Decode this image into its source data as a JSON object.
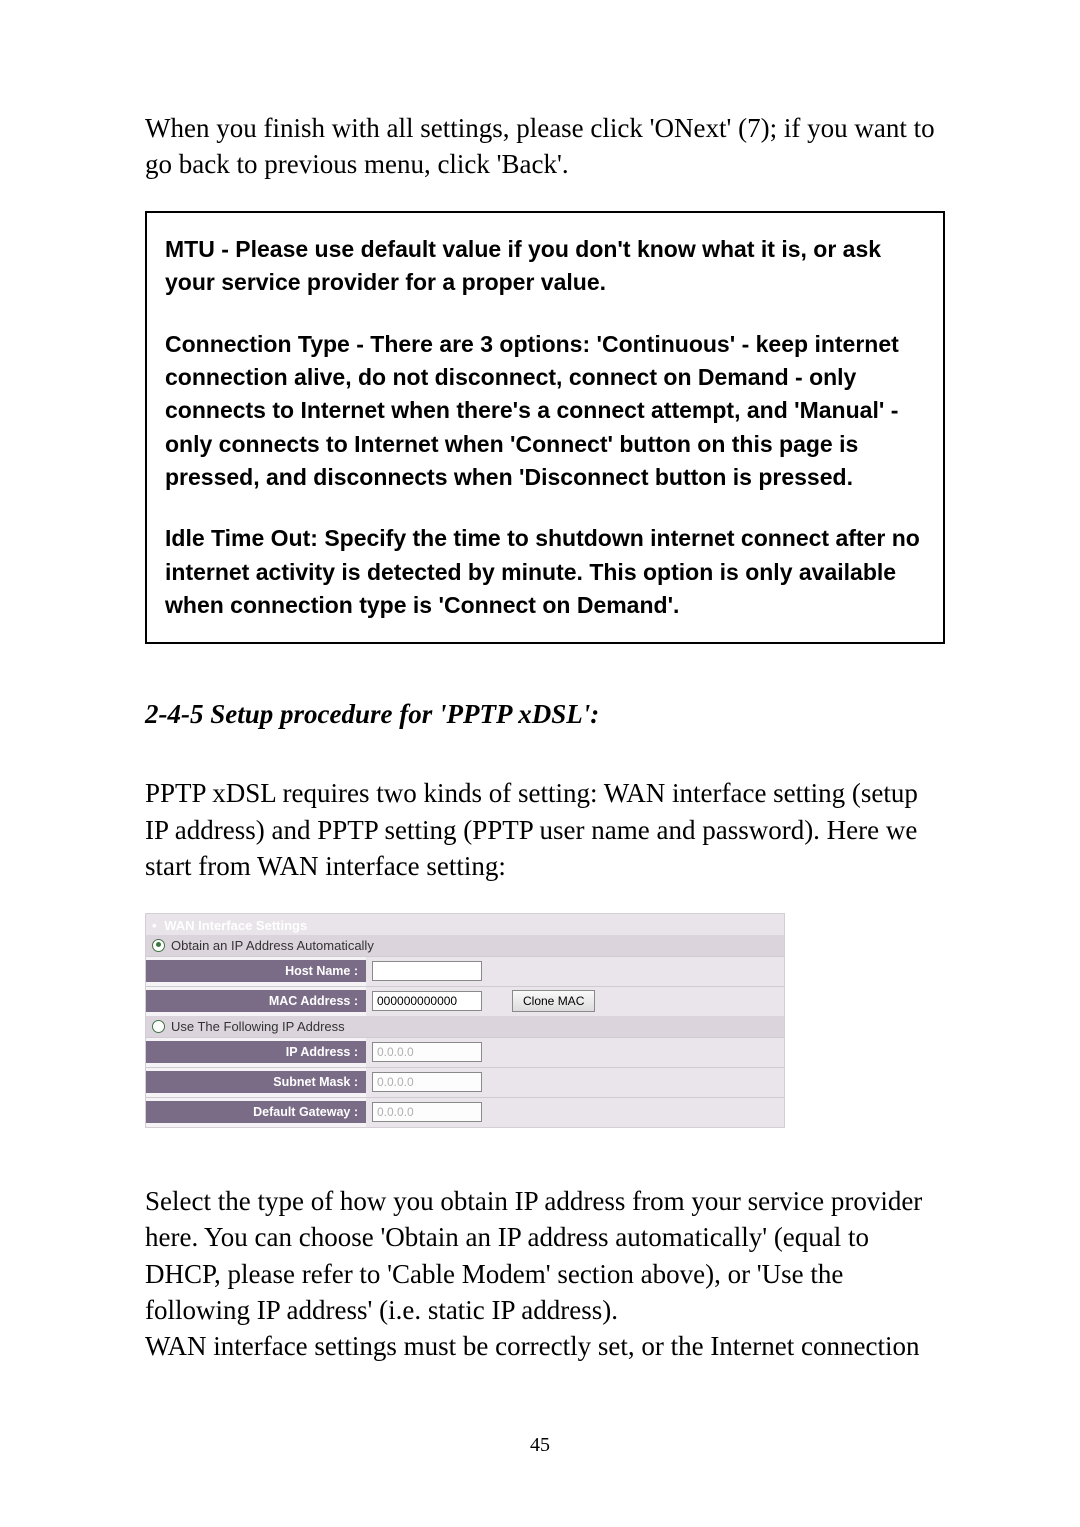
{
  "intro_text": "When you finish with all settings, please click 'ONext' (7); if you want to go back to previous menu, click 'Back'.",
  "note": {
    "mtu": "MTU - Please use default value if you don't know what it is, or ask your service provider for a proper value.",
    "connection_type": "Connection Type - There are 3 options: 'Continuous' - keep internet connection alive, do not disconnect, connect on Demand - only connects to Internet when there's a connect attempt, and 'Manual' - only connects to Internet when 'Connect' button on this page is pressed, and disconnects when 'Disconnect button is pressed.",
    "idle_timeout": "Idle Time Out: Specify the time to shutdown internet connect after no internet activity is detected by minute. This option is only available when connection type is 'Connect on Demand'."
  },
  "section_heading": "2-4-5 Setup procedure for 'PPTP xDSL':",
  "pptp_intro": "PPTP xDSL requires two kinds of setting: WAN interface setting (setup IP address) and PPTP setting (PPTP user name and password). Here we start from WAN interface setting:",
  "screenshot": {
    "header": "WAN Interface Settings",
    "radio_auto": "Obtain an IP Address Automatically",
    "radio_static": "Use The Following IP Address",
    "labels": {
      "host_name": "Host Name :",
      "mac_address": "MAC Address :",
      "ip_address": "IP Address :",
      "subnet_mask": "Subnet Mask :",
      "default_gateway": "Default Gateway :"
    },
    "values": {
      "host_name": "",
      "mac_address": "000000000000",
      "ip_address": "0.0.0.0",
      "subnet_mask": "0.0.0.0",
      "default_gateway": "0.0.0.0"
    },
    "clone_mac_button": "Clone MAC"
  },
  "after_text_1": "Select the type of how you obtain IP address from your service provider here. You can choose 'Obtain an IP address automatically' (equal to DHCP, please refer to 'Cable Modem' section above), or 'Use the following IP address' (i.e. static IP address).",
  "after_text_2": "WAN interface settings must be correctly set, or the Internet connection",
  "page_number": "45"
}
